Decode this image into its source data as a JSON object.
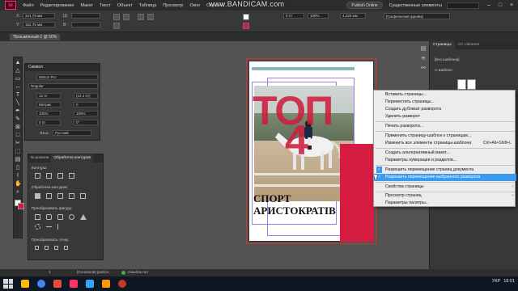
{
  "menubar": {
    "app_logo": "Id",
    "items": [
      "Файл",
      "Редактирование",
      "Макет",
      "Текст",
      "Объект",
      "Таблица",
      "Просмотр",
      "Окно",
      "Справка"
    ],
    "publish_label": "Publish Online",
    "workspace_label": "Существенные элементы",
    "window_controls": [
      "–",
      "□",
      "×"
    ]
  },
  "watermark": "www.BANDICAM.com",
  "controlbar": {
    "x_label": "X:",
    "x_value": "341,79 мм",
    "y_label": "Y:",
    "y_value": "162,75 мм",
    "w_label": "Ш:",
    "h_label": "В:",
    "stroke_value": "0 пт",
    "percent_value": "100%",
    "size_value": "4,233 мм",
    "frame_style": "[Графический фрейм]"
  },
  "doc_tab": "*Безымянный-1 @ 50%",
  "character_panel": {
    "title": "Символ",
    "font": "Minion Pro",
    "style": "Regular",
    "size": "12 пт",
    "leading": "(14,4 пт)",
    "kerning": "Метрик",
    "tracking": "0",
    "vscale": "100%",
    "hscale": "100%",
    "baseline": "0 пт",
    "skew": "0°",
    "language_label": "Язык:",
    "language": "Русский"
  },
  "pathfinder_panel": {
    "tabs": [
      "Выравнив",
      "Обработка контуров"
    ],
    "sections": [
      "Контуры:",
      "Обработка контуров:",
      "Преобразовать фигуру:",
      "Преобразовать точку:"
    ]
  },
  "document": {
    "title_big": "ТОП",
    "number_big": "4",
    "headline_line1": "СПОРТ",
    "headline_line2": "АРИСТОКРАТІВ"
  },
  "right_dock": {
    "tabs": [
      "Страницы",
      "CC Libraries"
    ],
    "none_label": "[Без шаблона]",
    "master_label": "A-Шаблон"
  },
  "context_menu": {
    "items": [
      {
        "label": "Вставить страницы...",
        "shortcut": "",
        "submenu": false,
        "checked": false,
        "highlight": false
      },
      {
        "label": "Переместить страницы...",
        "shortcut": "",
        "submenu": false,
        "checked": false,
        "highlight": false
      },
      {
        "label": "Создать дубликат разворота",
        "shortcut": "",
        "submenu": false,
        "checked": false,
        "highlight": false
      },
      {
        "label": "Удалить разворот",
        "shortcut": "",
        "submenu": false,
        "checked": false,
        "highlight": false
      },
      {
        "label": "Печать разворота...",
        "shortcut": "",
        "submenu": false,
        "checked": false,
        "highlight": false
      },
      {
        "label": "Применить страницу-шаблон к страницам...",
        "shortcut": "",
        "submenu": false,
        "checked": false,
        "highlight": false
      },
      {
        "label": "Изменить все элементы страницы-шаблона",
        "shortcut": "Ctrl+Alt+Shift+L",
        "submenu": false,
        "checked": false,
        "highlight": false
      },
      {
        "label": "Создать альтернативный макет...",
        "shortcut": "",
        "submenu": false,
        "checked": false,
        "highlight": false
      },
      {
        "label": "Параметры нумерации и разделов...",
        "shortcut": "",
        "submenu": false,
        "checked": false,
        "highlight": false
      },
      {
        "label": "Разрешить перемещение страниц документа",
        "shortcut": "",
        "submenu": false,
        "checked": true,
        "highlight": false
      },
      {
        "label": "Разрешить перемещение выбранного разворота",
        "shortcut": "",
        "submenu": false,
        "checked": true,
        "highlight": true
      },
      {
        "label": "Свойства страницы",
        "shortcut": "",
        "submenu": true,
        "checked": false,
        "highlight": false
      },
      {
        "label": "Просмотр страниц",
        "shortcut": "",
        "submenu": true,
        "checked": false,
        "highlight": false
      },
      {
        "label": "Параметры палитры...",
        "shortcut": "",
        "submenu": false,
        "checked": false,
        "highlight": false
      }
    ]
  },
  "statusbar": {
    "page_number": "1",
    "master": "[Основной] (рабоч...",
    "errors": "Ошибок нет"
  },
  "taskbar": {
    "lang": "УКР",
    "time": "18:01"
  },
  "colors": {
    "accent_red": "#d61c40",
    "menu_highlight": "#3d9bef",
    "indesign_logo": "#ff3366"
  }
}
